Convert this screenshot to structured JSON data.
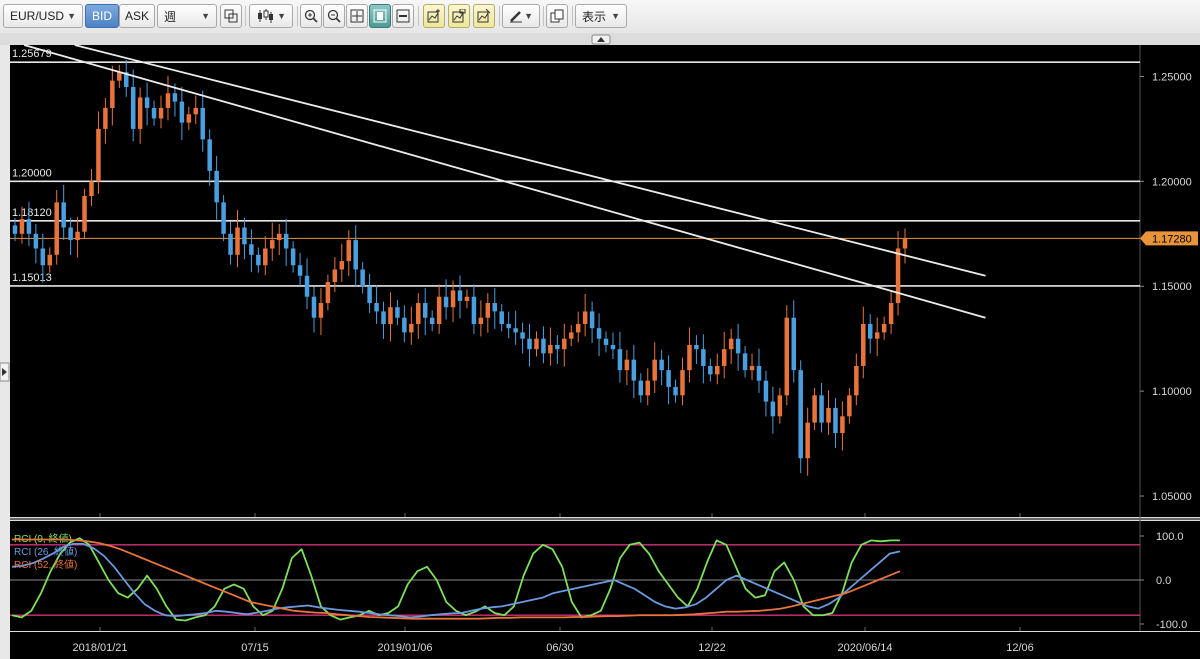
{
  "toolbar": {
    "symbol": "EUR/USD",
    "bid_label": "BID",
    "ask_label": "ASK",
    "timeframe": "週",
    "display_label": "表示"
  },
  "colors": {
    "background": "#000000",
    "up_candle": "#e8743b",
    "down_candle": "#4a9fe0",
    "price_line": "#e8943a",
    "rci9": "#7ee05a",
    "rci26": "#6a9be0",
    "rci52": "#e8743b",
    "band": "#d2307c"
  },
  "chart_data": [
    {
      "type": "candlestick",
      "symbol": "EUR/USD",
      "timeframe": "週",
      "ylim": [
        1.04,
        1.265
      ],
      "y_ticks": [
        "1.25000",
        "1.20000",
        "1.15000",
        "1.10000",
        "1.05000"
      ],
      "x_ticks": [
        "2018/01/21",
        "07/15",
        "2019/01/06",
        "06/30",
        "12/22",
        "2020/06/14",
        "12/06"
      ],
      "current_price": "1.17280",
      "levels": [
        {
          "value": 1.25679,
          "label": "1.25679"
        },
        {
          "value": 1.2,
          "label": "1.20000"
        },
        {
          "value": 1.1812,
          "label": "1.18120"
        },
        {
          "value": 1.15013,
          "label": "1.15013"
        }
      ],
      "trend_lines": [
        [
          [
            "2017-10",
            1.265
          ],
          [
            "2020-12",
            1.135
          ]
        ],
        [
          [
            "2017-12",
            1.265
          ],
          [
            "2020-12",
            1.155
          ]
        ]
      ],
      "closes": [
        1.175,
        1.182,
        1.175,
        1.168,
        1.16,
        1.165,
        1.19,
        1.178,
        1.172,
        1.176,
        1.193,
        1.2,
        1.225,
        1.235,
        1.248,
        1.252,
        1.245,
        1.225,
        1.24,
        1.235,
        1.23,
        1.235,
        1.242,
        1.238,
        1.228,
        1.232,
        1.235,
        1.22,
        1.205,
        1.19,
        1.175,
        1.165,
        1.178,
        1.17,
        1.165,
        1.16,
        1.168,
        1.172,
        1.175,
        1.168,
        1.16,
        1.155,
        1.145,
        1.135,
        1.142,
        1.152,
        1.158,
        1.162,
        1.172,
        1.158,
        1.15,
        1.142,
        1.138,
        1.132,
        1.14,
        1.135,
        1.128,
        1.132,
        1.142,
        1.135,
        1.132,
        1.145,
        1.14,
        1.148,
        1.143,
        1.145,
        1.132,
        1.135,
        1.142,
        1.138,
        1.132,
        1.13,
        1.128,
        1.125,
        1.12,
        1.125,
        1.118,
        1.122,
        1.12,
        1.125,
        1.128,
        1.132,
        1.138,
        1.13,
        1.125,
        1.122,
        1.12,
        1.11,
        1.115,
        1.105,
        1.098,
        1.105,
        1.115,
        1.11,
        1.102,
        1.098,
        1.11,
        1.122,
        1.12,
        1.112,
        1.108,
        1.112,
        1.12,
        1.125,
        1.118,
        1.11,
        1.112,
        1.105,
        1.095,
        1.088,
        1.098,
        1.135,
        1.11,
        1.068,
        1.085,
        1.098,
        1.085,
        1.092,
        1.08,
        1.088,
        1.098,
        1.112,
        1.132,
        1.125,
        1.128,
        1.132,
        1.142,
        1.168,
        1.1728
      ]
    },
    {
      "type": "line",
      "ylim": [
        -100,
        100
      ],
      "y_ticks": [
        "100.0",
        "0.0",
        "-100.0"
      ],
      "bands": [
        80,
        -80
      ],
      "series": [
        {
          "name": "RCI (9, 終値)",
          "values": [
            -80,
            -85,
            -70,
            -30,
            20,
            60,
            85,
            95,
            80,
            40,
            0,
            -30,
            -40,
            -20,
            10,
            -20,
            -60,
            -90,
            -92,
            -85,
            -80,
            -60,
            -20,
            -10,
            -20,
            -60,
            -80,
            -70,
            -20,
            50,
            70,
            10,
            -60,
            -80,
            -90,
            -85,
            -80,
            -70,
            -80,
            -75,
            -60,
            -10,
            20,
            30,
            0,
            -50,
            -70,
            -80,
            -72,
            -60,
            -75,
            -80,
            -60,
            10,
            60,
            80,
            70,
            30,
            -50,
            -85,
            -80,
            -70,
            -20,
            50,
            80,
            85,
            60,
            20,
            -10,
            -40,
            -60,
            -20,
            40,
            90,
            80,
            30,
            -20,
            -40,
            -35,
            20,
            40,
            0,
            -60,
            -80,
            -80,
            -75,
            -30,
            40,
            80,
            90,
            88,
            90,
            90
          ]
        },
        {
          "name": "RCI (26, 終値)",
          "values": [
            30,
            32,
            38,
            48,
            60,
            75,
            82,
            82,
            72,
            55,
            30,
            0,
            -30,
            -55,
            -70,
            -80,
            -82,
            -80,
            -78,
            -75,
            -70,
            -72,
            -75,
            -78,
            -74,
            -70,
            -65,
            -62,
            -60,
            -58,
            -62,
            -65,
            -68,
            -70,
            -72,
            -75,
            -78,
            -80,
            -82,
            -85,
            -83,
            -80,
            -78,
            -76,
            -75,
            -70,
            -65,
            -62,
            -60,
            -55,
            -50,
            -45,
            -40,
            -30,
            -25,
            -20,
            -15,
            -10,
            -5,
            0,
            -10,
            -20,
            -35,
            -50,
            -60,
            -65,
            -62,
            -55,
            -40,
            -20,
            0,
            10,
            0,
            -10,
            -20,
            -30,
            -40,
            -50,
            -60,
            -65,
            -55,
            -40,
            -20,
            0,
            20,
            40,
            60,
            65
          ]
        },
        {
          "name": "RCI (52, 終値)",
          "values": [
            92,
            92,
            92,
            92,
            92,
            92,
            90,
            88,
            84,
            78,
            70,
            60,
            50,
            40,
            30,
            20,
            10,
            0,
            -10,
            -20,
            -30,
            -40,
            -50,
            -55,
            -60,
            -65,
            -70,
            -72,
            -74,
            -75,
            -78,
            -80,
            -82,
            -84,
            -85,
            -86,
            -87,
            -88,
            -88,
            -88,
            -88,
            -88,
            -88,
            -88,
            -87,
            -86,
            -86,
            -85,
            -85,
            -85,
            -85,
            -85,
            -84,
            -84,
            -83,
            -82,
            -82,
            -81,
            -80,
            -80,
            -80,
            -80,
            -79,
            -78,
            -76,
            -74,
            -72,
            -72,
            -71,
            -70,
            -68,
            -65,
            -60,
            -54,
            -48,
            -42,
            -36,
            -30,
            -20,
            -10,
            0,
            10,
            20
          ]
        }
      ]
    }
  ]
}
